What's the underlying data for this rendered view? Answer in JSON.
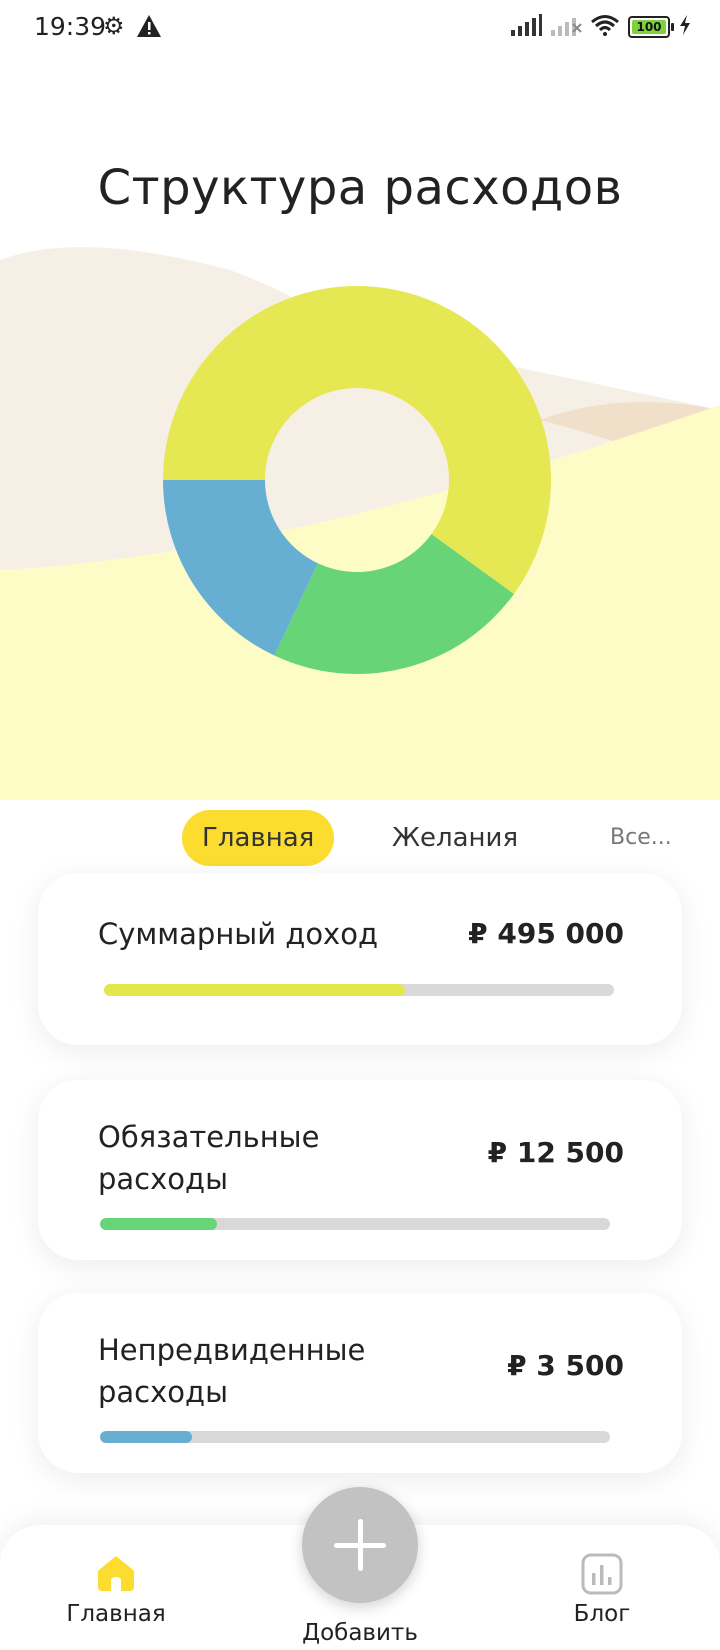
{
  "status_bar": {
    "time": "19:39",
    "battery": "100",
    "icons": [
      "gear-icon",
      "alert-icon",
      "signal-icon",
      "signal-off-icon",
      "wifi-icon",
      "battery-icon",
      "charging-icon"
    ]
  },
  "page": {
    "title": "Структура расходов"
  },
  "chart_data": {
    "type": "pie",
    "variant": "donut",
    "values": [
      0.6,
      0.22,
      0.18
    ],
    "colors": [
      "#e6e853",
      "#67d478",
      "#66afd3"
    ]
  },
  "tabs": [
    {
      "label": "Главная",
      "active": true
    },
    {
      "label": "Желания",
      "active": false
    },
    {
      "label": "Все...",
      "active": false
    }
  ],
  "cards": [
    {
      "label": "Суммарный доход",
      "amount": "₽ 495 000",
      "progress": 0.59,
      "color": "#e2e74c"
    },
    {
      "label": "Обязательные расходы",
      "amount": "₽ 12 500",
      "progress": 0.23,
      "color": "#67d478"
    },
    {
      "label": "Непредвиденные расходы",
      "amount": "₽ 3 500",
      "progress": 0.18,
      "color": "#66afd3"
    }
  ],
  "nav": {
    "home": "Главная",
    "add": "Добавить",
    "blog": "Блог"
  },
  "colors": {
    "accent": "#fcdc2f",
    "fab": "#c2c2c2",
    "home_icon": "#fcdc2f"
  }
}
